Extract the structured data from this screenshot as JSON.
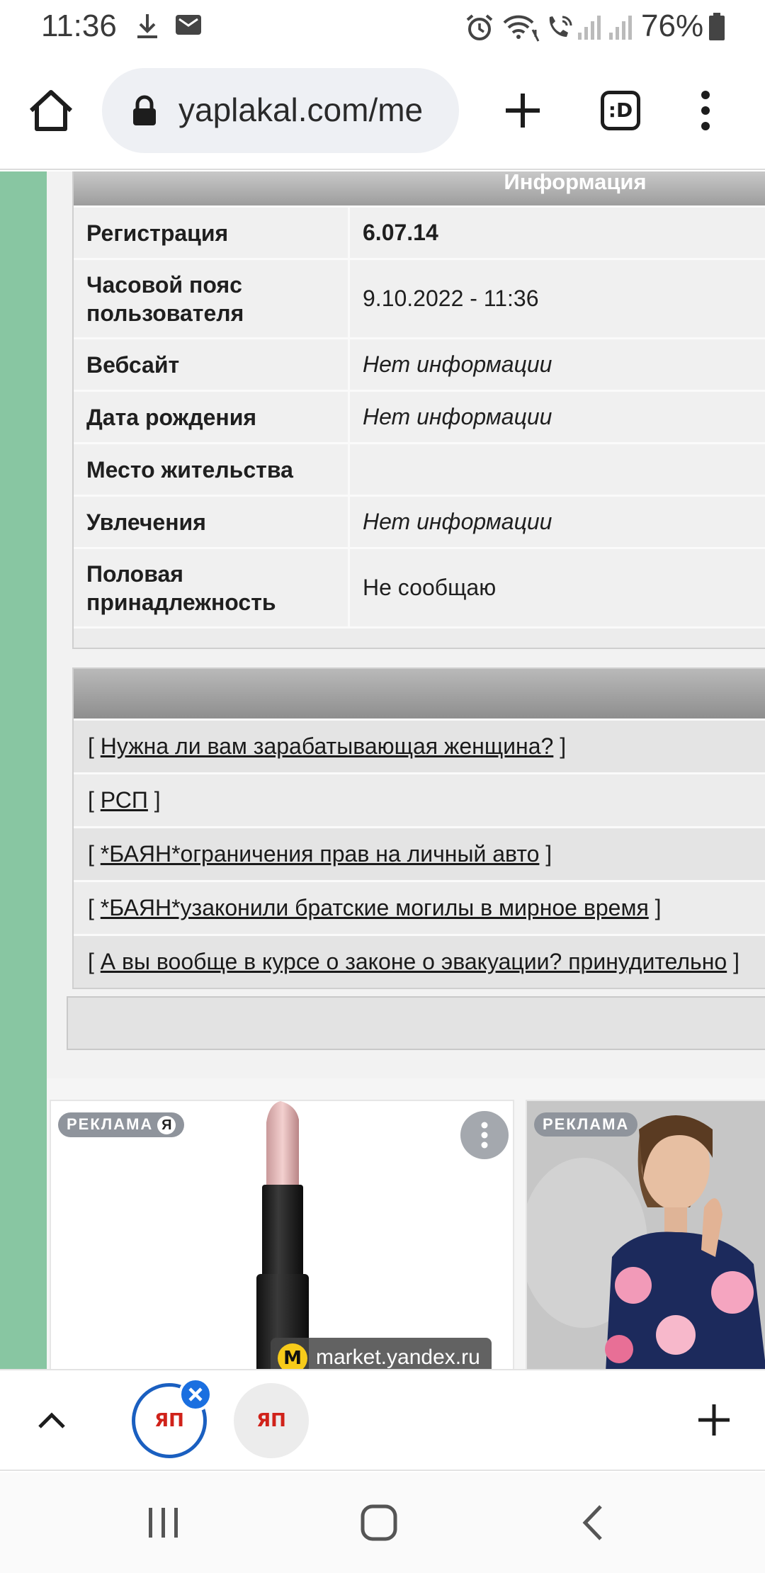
{
  "status_bar": {
    "time": "11:36",
    "battery": "76%",
    "icons": [
      "download-icon",
      "mail-icon",
      "alarm-icon",
      "wifi-call-icon",
      "volte-call-icon",
      "signal-icon",
      "battery-icon"
    ]
  },
  "browser": {
    "url": "yaplakal.com/me",
    "tab_count_label": ":D",
    "icons": [
      "home-icon",
      "lock-icon",
      "new-tab-plus-icon",
      "menu-dots-icon"
    ]
  },
  "profile": {
    "section_title": "Информация",
    "rows": [
      {
        "label": "Регистрация",
        "value": "6.07.14"
      },
      {
        "label": "Часовой пояс пользователя",
        "value": "9.10.2022 - 11:36"
      },
      {
        "label": "Вебсайт",
        "value": "Нет информации"
      },
      {
        "label": "Дата рождения",
        "value": "Нет информации"
      },
      {
        "label": "Место жительства",
        "value": ""
      },
      {
        "label": "Увлечения",
        "value": "Нет информации"
      },
      {
        "label": "Половая принадлежность",
        "value": "Не сообщаю"
      }
    ]
  },
  "topics": {
    "items": [
      "Нужна ли вам зарабатывающая женщина?",
      "РСП",
      "*БАЯН*ограничения прав на личный авто",
      "*БАЯН*узаконили братские могилы в мирное время",
      "А вы вообще в курсе о законе о эвакуации? принудительно"
    ]
  },
  "ads": {
    "badge_label": "РЕКЛАМА",
    "yandex_mark": "Я",
    "domain": "market.yandex.ru",
    "market_logo": "M"
  },
  "tab_strip": {
    "favicon_label": "ЯП"
  },
  "colors": {
    "accent": "#1a6fe0",
    "side_strip": "#88c6a2"
  }
}
